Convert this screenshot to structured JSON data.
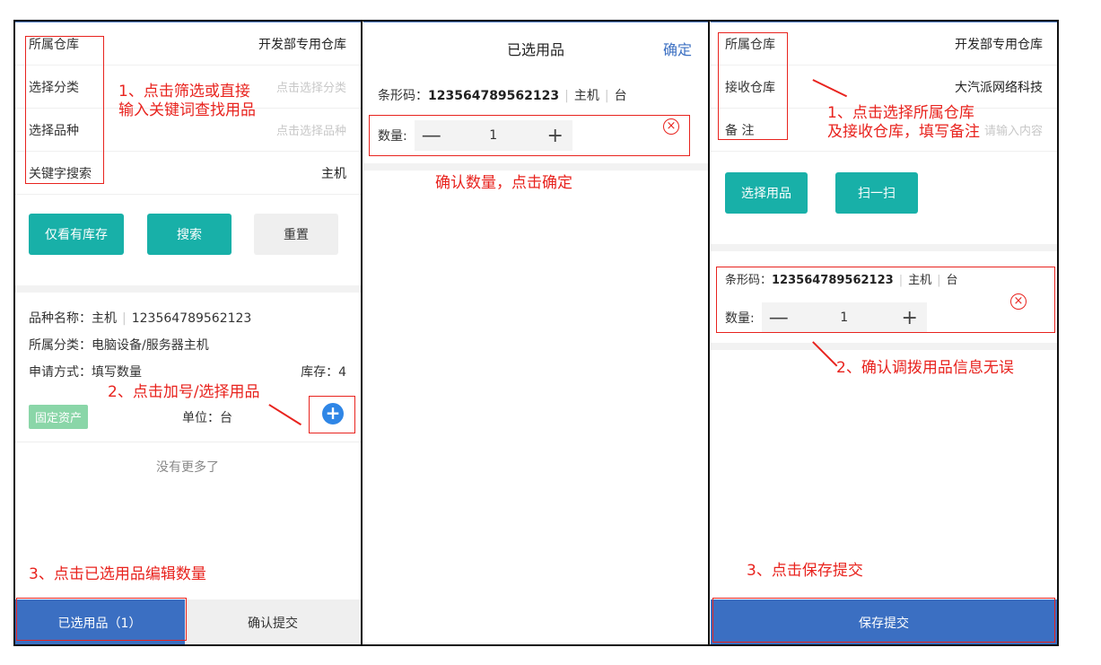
{
  "panel1": {
    "rows": [
      {
        "label": "所属仓库",
        "value": "开发部专用仓库"
      },
      {
        "label": "选择分类",
        "placeholder": "点击选择分类"
      },
      {
        "label": "选择品种",
        "placeholder": "点击选择品种"
      },
      {
        "label": "关键字搜索",
        "value": "主机"
      }
    ],
    "buttons": {
      "stock_only": "仅看有库存",
      "search": "搜索",
      "reset": "重置"
    },
    "item": {
      "name_line": "品种名称：主机",
      "code": "123564789562123",
      "category": "所属分类：电脑设备/服务器主机",
      "apply_mode": "申请方式：填写数量",
      "stock": "库存：4",
      "tag": "固定资产",
      "unit": "单位：台"
    },
    "no_more": "没有更多了",
    "bottom": {
      "selected": "已选用品（1）",
      "confirm": "确认提交"
    },
    "annotations": {
      "a1_line1": "1、点击筛选或直接",
      "a1_line2": "输入关键词查找用品",
      "a2": "2、点击加号/选择用品",
      "a3": "3、点击已选用品编辑数量"
    }
  },
  "panel2": {
    "title": "已选用品",
    "confirm": "确定",
    "barcode_label": "条形码：",
    "barcode": "123564789562123",
    "item_name": "主机",
    "unit": "台",
    "qty_label": "数量:",
    "qty_value": "1",
    "minus": "—",
    "plus": "+",
    "remove": "×",
    "annotation": "确认数量，点击确定"
  },
  "panel3": {
    "rows": [
      {
        "label": "所属仓库",
        "value": "开发部专用仓库"
      },
      {
        "label": "接收仓库",
        "value": "大汽派网络科技"
      },
      {
        "label": "备 注",
        "placeholder": "请输入内容"
      }
    ],
    "buttons": {
      "select_item": "选择用品",
      "scan": "扫一扫"
    },
    "barcode_label": "条形码：",
    "barcode": "123564789562123",
    "item_name": "主机",
    "unit": "台",
    "qty_label": "数量:",
    "qty_value": "1",
    "minus": "—",
    "plus": "+",
    "remove": "×",
    "save": "保存提交",
    "annotations": {
      "a1_line1": "1、点击选择所属仓库",
      "a1_line2": "及接收仓库，填写备注",
      "a2": "2、确认调拨用品信息无误",
      "a3": "3、点击保存提交"
    }
  }
}
